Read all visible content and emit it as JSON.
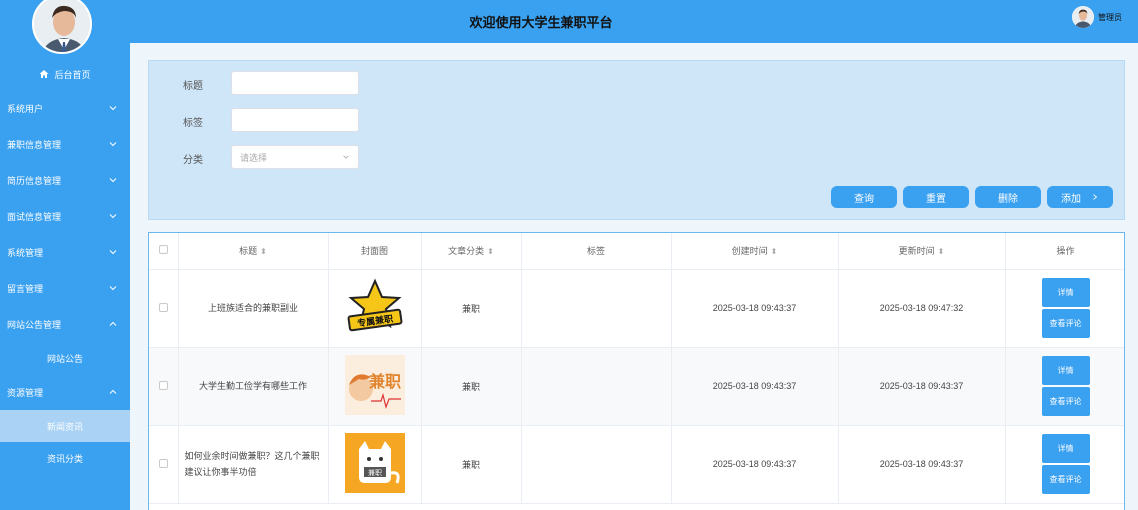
{
  "header": {
    "title": "欢迎使用大学生兼职平台",
    "user": "管理员"
  },
  "sidebar": {
    "home": "后台首页",
    "items": [
      {
        "label": "系统用户",
        "expanded": false
      },
      {
        "label": "兼职信息管理",
        "expanded": false
      },
      {
        "label": "简历信息管理",
        "expanded": false
      },
      {
        "label": "面试信息管理",
        "expanded": false
      },
      {
        "label": "系统管理",
        "expanded": false
      },
      {
        "label": "留言管理",
        "expanded": false
      },
      {
        "label": "网站公告管理",
        "expanded": true,
        "children": [
          "网站公告"
        ]
      },
      {
        "label": "资源管理",
        "expanded": true,
        "children": [
          "新闻资讯",
          "资讯分类"
        ]
      }
    ],
    "active_child": "新闻资讯"
  },
  "search": {
    "title_label": "标题",
    "tag_label": "标签",
    "category_label": "分类",
    "category_placeholder": "请选择",
    "buttons": {
      "query": "查询",
      "reset": "重置",
      "delete": "删除",
      "add": "添加"
    }
  },
  "table": {
    "headers": {
      "title": "标题",
      "cover": "封面图",
      "category": "文章分类",
      "tags": "标签",
      "created": "创建时间",
      "updated": "更新时间",
      "ops": "操作"
    },
    "rows": [
      {
        "title": "上班族适合的兼职副业",
        "cover_text": "专属兼职",
        "category": "兼职",
        "tags": "",
        "created": "2025-03-18 09:43:37",
        "updated": "2025-03-18 09:47:32"
      },
      {
        "title": "大学生勤工俭学有哪些工作",
        "cover_text": "兼职",
        "category": "兼职",
        "tags": "",
        "created": "2025-03-18 09:43:37",
        "updated": "2025-03-18 09:43:37"
      },
      {
        "title": "如何业余时间做兼职？这几个兼职建议让你事半功倍",
        "cover_text": "兼职",
        "category": "兼职",
        "tags": "",
        "created": "2025-03-18 09:43:37",
        "updated": "2025-03-18 09:43:37"
      }
    ],
    "op_detail": "详情",
    "op_comments": "查看评论"
  },
  "colors": {
    "primary": "#3aa0f0",
    "active_menu": "#a9d2f5",
    "panel": "#cfe5f8"
  }
}
